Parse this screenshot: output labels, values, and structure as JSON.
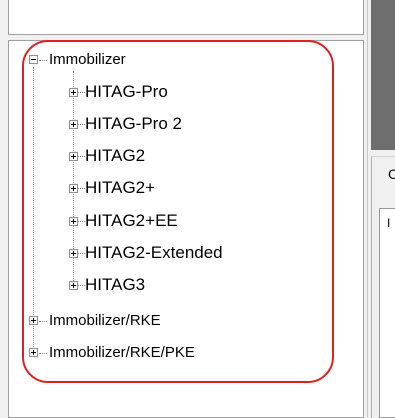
{
  "tree": {
    "root": {
      "label": "Immobilizer",
      "state": "expanded"
    },
    "children": [
      {
        "label": "HITAG-Pro"
      },
      {
        "label": "HITAG-Pro 2"
      },
      {
        "label": "HITAG2"
      },
      {
        "label": "HITAG2+"
      },
      {
        "label": "HITAG2+EE"
      },
      {
        "label": "HITAG2-Extended"
      },
      {
        "label": "HITAG3"
      }
    ],
    "siblings": [
      {
        "label": "Immobilizer/RKE",
        "state": "collapsed"
      },
      {
        "label": "Immobilizer/RKE/PKE",
        "state": "collapsed"
      }
    ]
  },
  "right_panel": {
    "group_label": "C",
    "field_char": "I"
  },
  "highlight": {
    "color": "#e02020"
  }
}
